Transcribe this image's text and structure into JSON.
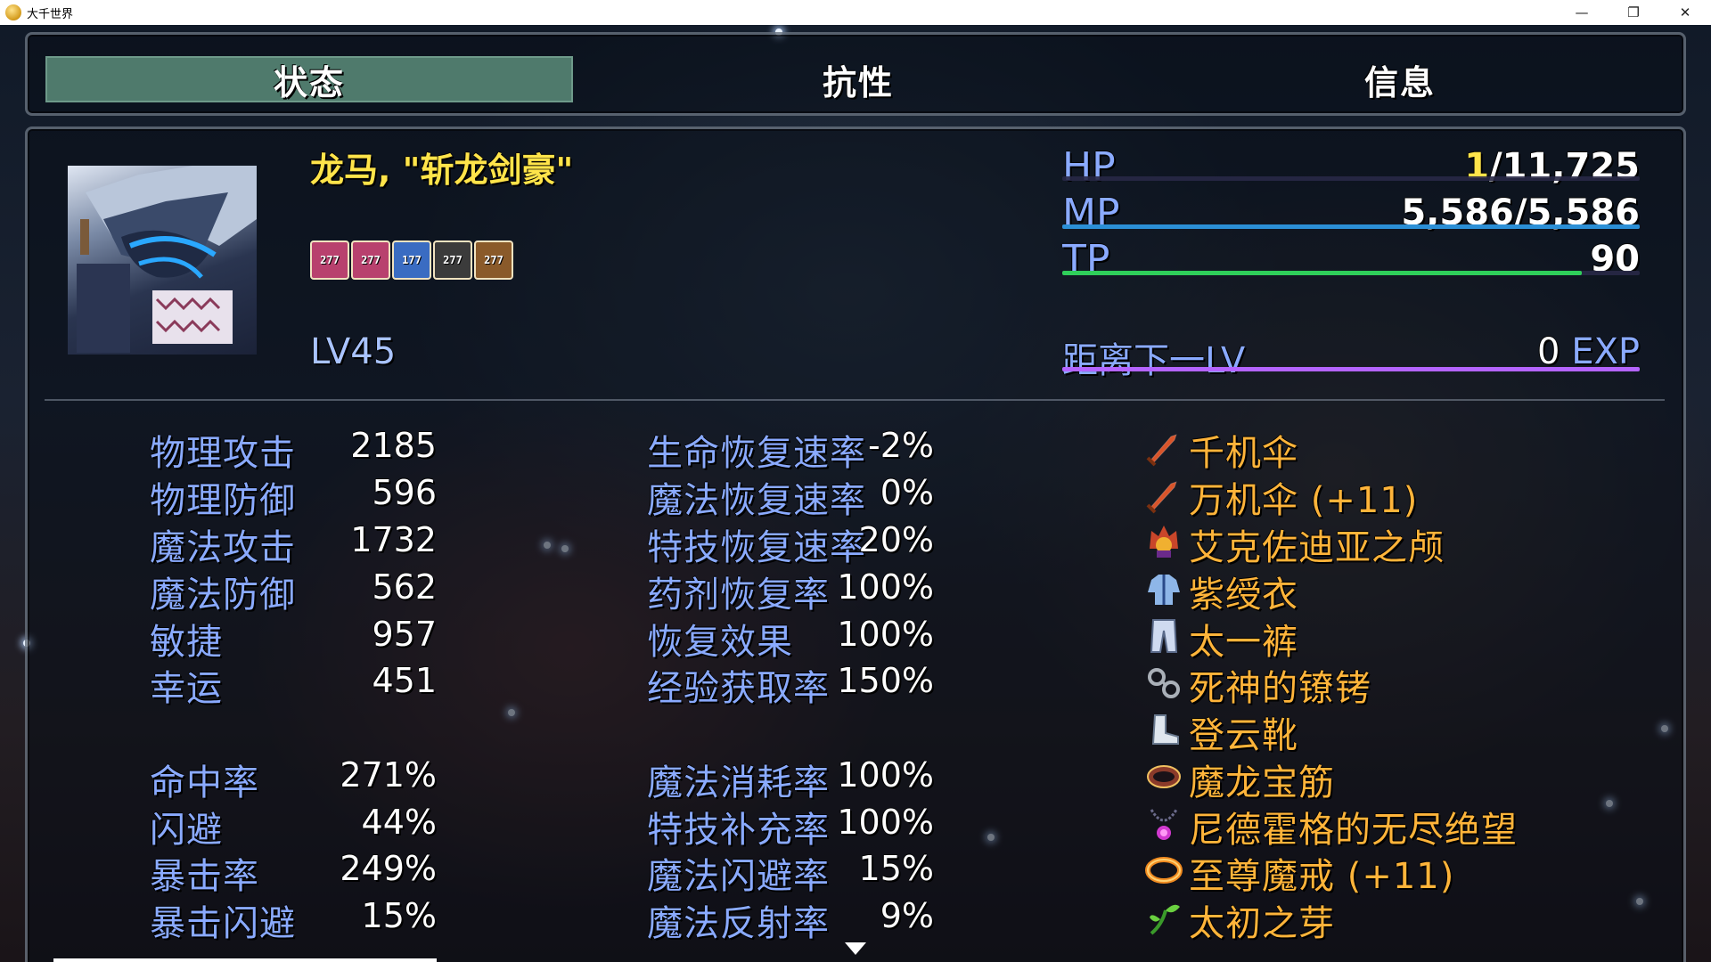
{
  "window": {
    "title": "大千世界",
    "controls": [
      "—",
      "❐",
      "✕"
    ]
  },
  "tabs": [
    {
      "label": "状态",
      "active": true
    },
    {
      "label": "抗性",
      "active": false
    },
    {
      "label": "信息",
      "active": false
    }
  ],
  "actor": {
    "name": "龙马, \"斩龙剑豪\"",
    "level_label": "LV",
    "level": "45",
    "state_icons": [
      {
        "name": "state-icon",
        "turns": "277",
        "color": "#b8416e"
      },
      {
        "name": "state-icon",
        "turns": "277",
        "color": "#b8416e"
      },
      {
        "name": "state-icon",
        "turns": "177",
        "color": "#3a6cc2"
      },
      {
        "name": "state-icon",
        "turns": "277",
        "color": "#3b3b3b"
      },
      {
        "name": "state-icon",
        "turns": "277",
        "color": "#8a5a2a"
      }
    ]
  },
  "gauges": [
    {
      "label": "HP",
      "current": "1",
      "sep": "/",
      "max": "11,725",
      "fill": 0.0001,
      "color": "#4a5cc8",
      "current_color": "#ffe44a"
    },
    {
      "label": "MP",
      "current": "5,586",
      "sep": "/",
      "max": "5,586",
      "fill": 1.0,
      "color": "#2b8fd6",
      "current_color": "#ffffff"
    },
    {
      "label": "TP",
      "current": "90",
      "sep": "",
      "max": "",
      "fill": 0.9,
      "color": "#2fcf5a",
      "current_color": "#ffffff"
    }
  ],
  "exp": {
    "label": "距离下一LV",
    "value": "0",
    "unit": "EXP",
    "color": "#b464ff"
  },
  "params_left": [
    {
      "label": "物理攻击",
      "value": "2185"
    },
    {
      "label": "物理防御",
      "value": "596"
    },
    {
      "label": "魔法攻击",
      "value": "1732"
    },
    {
      "label": "魔法防御",
      "value": "562"
    },
    {
      "label": "敏捷",
      "value": "957"
    },
    {
      "label": "幸运",
      "value": "451"
    },
    {
      "label": "命中率",
      "value": "271%"
    },
    {
      "label": "闪避",
      "value": "44%"
    },
    {
      "label": "暴击率",
      "value": "249%"
    },
    {
      "label": "暴击闪避",
      "value": "15%"
    }
  ],
  "params_mid": [
    {
      "label": "生命恢复速率",
      "value": "-2%"
    },
    {
      "label": "魔法恢复速率",
      "value": "0%"
    },
    {
      "label": "特技恢复速率",
      "value": "20%"
    },
    {
      "label": "药剂恢复率",
      "value": "100%"
    },
    {
      "label": "恢复效果",
      "value": "100%"
    },
    {
      "label": "经验获取率",
      "value": "150%"
    },
    {
      "label": "魔法消耗率",
      "value": "100%"
    },
    {
      "label": "特技补充率",
      "value": "100%"
    },
    {
      "label": "魔法闪避率",
      "value": "15%"
    },
    {
      "label": "魔法反射率",
      "value": "9%"
    }
  ],
  "equipment": [
    {
      "name": "千机伞",
      "icon": "sword-icon"
    },
    {
      "name": "万机伞 (+11)",
      "icon": "sword-icon"
    },
    {
      "name": "艾克佐迪亚之颅",
      "icon": "helmet-icon"
    },
    {
      "name": "紫绶衣",
      "icon": "armor-icon"
    },
    {
      "name": "太一裤",
      "icon": "pants-icon"
    },
    {
      "name": "死神的镣铐",
      "icon": "shackle-icon"
    },
    {
      "name": "登云靴",
      "icon": "boot-icon"
    },
    {
      "name": "魔龙宝筋",
      "icon": "bracelet-icon"
    },
    {
      "name": "尼德霍格的无尽绝望",
      "icon": "necklace-icon"
    },
    {
      "name": "至尊魔戒 (+11)",
      "icon": "ring-icon"
    },
    {
      "name": "太初之芽",
      "icon": "sprout-icon"
    }
  ]
}
